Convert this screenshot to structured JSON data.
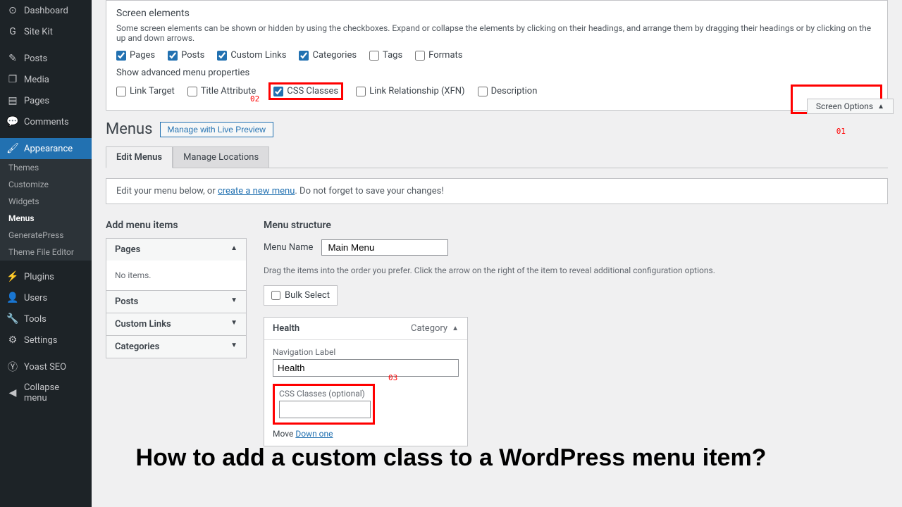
{
  "sidebar": {
    "items": [
      {
        "label": "Dashboard",
        "icon": "⊙"
      },
      {
        "label": "Site Kit",
        "icon": "G"
      },
      {
        "label": "Posts",
        "icon": "✎"
      },
      {
        "label": "Media",
        "icon": "❐"
      },
      {
        "label": "Pages",
        "icon": "▤"
      },
      {
        "label": "Comments",
        "icon": "💬"
      },
      {
        "label": "Appearance",
        "icon": "🖌",
        "active": true
      },
      {
        "label": "Plugins",
        "icon": "⚡"
      },
      {
        "label": "Users",
        "icon": "👤"
      },
      {
        "label": "Tools",
        "icon": "🔧"
      },
      {
        "label": "Settings",
        "icon": "⚙"
      },
      {
        "label": "Yoast SEO",
        "icon": "Ⓨ"
      },
      {
        "label": "Collapse menu",
        "icon": "◀"
      }
    ],
    "subs": [
      "Themes",
      "Customize",
      "Widgets",
      "Menus",
      "GeneratePress",
      "Theme File Editor"
    ]
  },
  "screen_elements": {
    "title": "Screen elements",
    "desc": "Some screen elements can be shown or hidden by using the checkboxes. Expand or collapse the elements by clicking on their headings, and arrange them by dragging their headings or by clicking on the up and down arrows.",
    "boxes": [
      {
        "label": "Pages",
        "checked": true
      },
      {
        "label": "Posts",
        "checked": true
      },
      {
        "label": "Custom Links",
        "checked": true
      },
      {
        "label": "Categories",
        "checked": true
      },
      {
        "label": "Tags",
        "checked": false
      },
      {
        "label": "Formats",
        "checked": false
      }
    ],
    "adv_title": "Show advanced menu properties",
    "adv": [
      {
        "label": "Link Target",
        "checked": false
      },
      {
        "label": "Title Attribute",
        "checked": false
      },
      {
        "label": "CSS Classes",
        "checked": true,
        "highlight": true
      },
      {
        "label": "Link Relationship (XFN)",
        "checked": false
      },
      {
        "label": "Description",
        "checked": false
      }
    ]
  },
  "screen_options_btn": "Screen Options",
  "annots": {
    "a1": "01",
    "a2": "02",
    "a3": "03"
  },
  "page": {
    "title": "Menus",
    "preview_btn": "Manage with Live Preview",
    "tabs": [
      "Edit Menus",
      "Manage Locations"
    ],
    "notice_pre": "Edit your menu below, or ",
    "notice_link": "create a new menu",
    "notice_post": ". Do not forget to save your changes!"
  },
  "add_items": {
    "title": "Add menu items",
    "accordions": [
      "Pages",
      "Posts",
      "Custom Links",
      "Categories"
    ],
    "empty": "No items."
  },
  "structure": {
    "title": "Menu structure",
    "name_label": "Menu Name",
    "name_value": "Main Menu",
    "hint": "Drag the items into the order you prefer. Click the arrow on the right of the item to reveal additional configuration options.",
    "bulk": "Bulk Select",
    "item": {
      "title": "Health",
      "type": "Category",
      "nav_label": "Navigation Label",
      "nav_value": "Health",
      "css_label": "CSS Classes (optional)",
      "css_value": "",
      "move": "Move",
      "move_link": "Down one"
    }
  },
  "headline": "How to add a custom class to a WordPress menu item?"
}
